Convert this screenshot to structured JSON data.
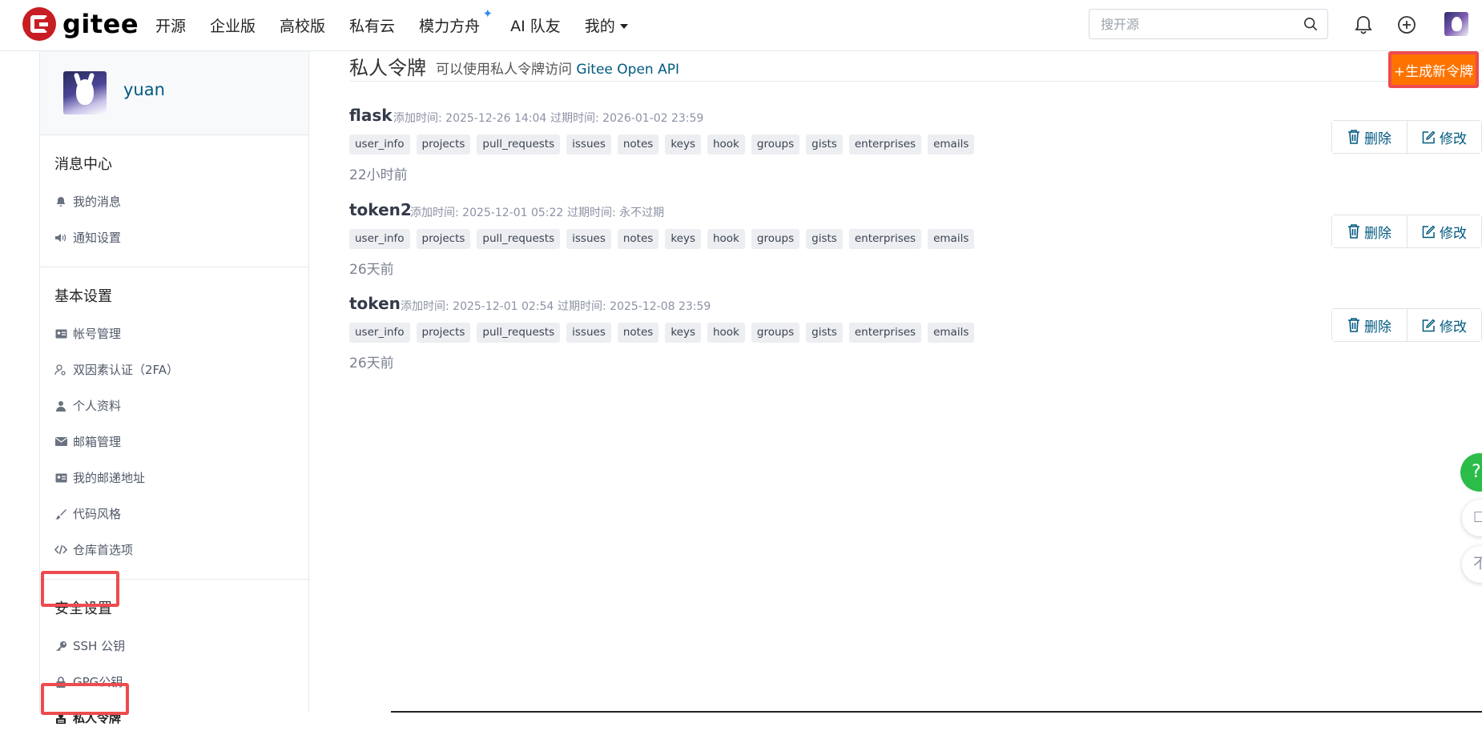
{
  "topnav": {
    "logo_text": "gitee",
    "items": [
      "开源",
      "企业版",
      "高校版",
      "私有云",
      "模力方舟",
      "AI 队友",
      "我的"
    ],
    "search_placeholder": "搜开源"
  },
  "sidebar": {
    "username": "yuan",
    "sections": [
      {
        "title": "消息中心",
        "items": [
          {
            "label": "我的消息",
            "icon": "bell-icon"
          },
          {
            "label": "通知设置",
            "icon": "speaker-icon"
          }
        ]
      },
      {
        "title": "基本设置",
        "items": [
          {
            "label": "帐号管理",
            "icon": "id-card-icon"
          },
          {
            "label": "双因素认证（2FA）",
            "icon": "user-key-icon"
          },
          {
            "label": "个人资料",
            "icon": "person-icon"
          },
          {
            "label": "邮箱管理",
            "icon": "mail-icon"
          },
          {
            "label": "我的邮递地址",
            "icon": "address-card-icon"
          },
          {
            "label": "代码风格",
            "icon": "brush-icon"
          },
          {
            "label": "仓库首选项",
            "icon": "code-icon"
          }
        ]
      },
      {
        "title": "安全设置",
        "items": [
          {
            "label": "SSH 公钥",
            "icon": "key-icon"
          },
          {
            "label": "GPG公钥",
            "icon": "lock-icon"
          },
          {
            "label": "私人令牌",
            "icon": "token-icon"
          }
        ]
      }
    ]
  },
  "main": {
    "title": "私人令牌",
    "subtitle_prefix": "可以使用私人令牌访问",
    "subtitle_link": "Gitee Open API",
    "generate_button": "+生成新令牌",
    "delete_label": "删除",
    "edit_label": "修改",
    "tokens": [
      {
        "name": "flask",
        "added_label": "添加时间:",
        "added": "2025-12-26 14:04",
        "expires_label": "过期时间:",
        "expires": "2026-01-02 23:59",
        "ago": "22小时前"
      },
      {
        "name": "token2",
        "added_label": "添加时间:",
        "added": "2025-12-01 05:22",
        "expires_label": "过期时间:",
        "expires": "永不过期",
        "ago": "26天前"
      },
      {
        "name": "token",
        "added_label": "添加时间:",
        "added": "2025-12-01 02:54",
        "expires_label": "过期时间:",
        "expires": "2025-12-08 23:59",
        "ago": "26天前"
      }
    ],
    "scopes": [
      "user_info",
      "projects",
      "pull_requests",
      "issues",
      "notes",
      "keys",
      "hook",
      "groups",
      "gists",
      "enterprises",
      "emails"
    ]
  },
  "floating": {
    "help": "?",
    "btn1": "☐",
    "btn2": "不"
  },
  "colors": {
    "brand": "#c71d23",
    "accent": "#fe7300",
    "link": "#005980",
    "highlight": "#ee4b4f",
    "help": "#2bbc4a"
  }
}
